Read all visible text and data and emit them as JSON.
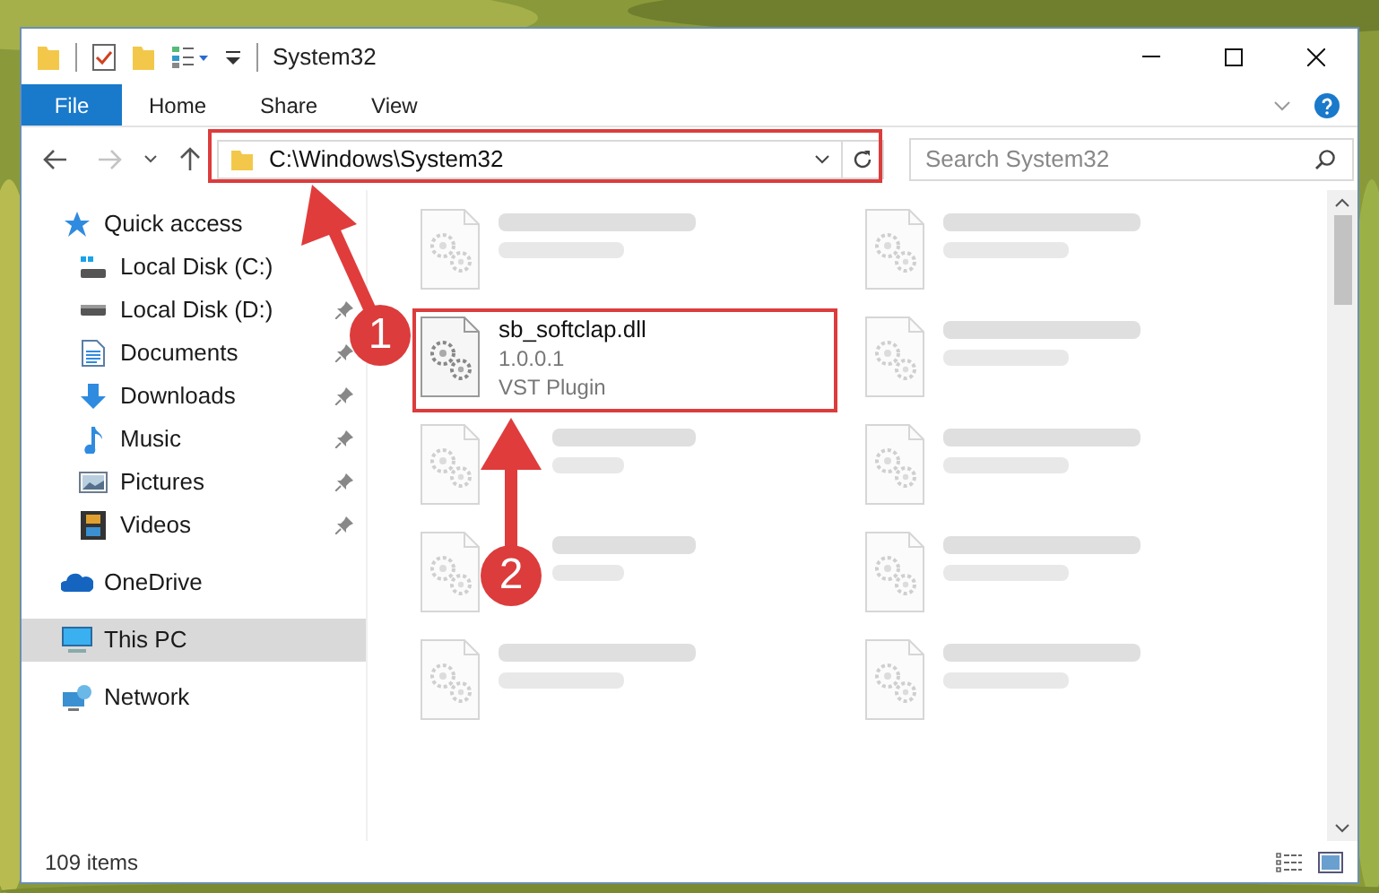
{
  "window": {
    "title": "System32"
  },
  "ribbon": {
    "tabs": [
      {
        "label": "File",
        "kind": "file"
      },
      {
        "label": "Home",
        "kind": "tab"
      },
      {
        "label": "Share",
        "kind": "tab"
      },
      {
        "label": "View",
        "kind": "tab"
      }
    ]
  },
  "address_bar": {
    "path": "C:\\Windows\\System32"
  },
  "search": {
    "placeholder": "Search System32"
  },
  "nav": {
    "items": [
      {
        "label": "Quick access",
        "kind": "star",
        "selected": false,
        "children": [
          {
            "label": "Local Disk (C:)",
            "kind": "diskc",
            "pinned": false,
            "selected": false
          },
          {
            "label": "Local Disk (D:)",
            "kind": "disk",
            "pinned": true,
            "selected": false
          },
          {
            "label": "Documents",
            "kind": "documents",
            "pinned": true,
            "selected": false
          },
          {
            "label": "Downloads",
            "kind": "downloads",
            "pinned": true,
            "selected": false
          },
          {
            "label": "Music",
            "kind": "music",
            "pinned": true,
            "selected": false
          },
          {
            "label": "Pictures",
            "kind": "pictures",
            "pinned": true,
            "selected": false
          },
          {
            "label": "Videos",
            "kind": "videos",
            "pinned": true,
            "selected": false
          }
        ]
      },
      {
        "label": "OneDrive",
        "kind": "cloud",
        "selected": false
      },
      {
        "label": "This PC",
        "kind": "pc",
        "selected": true
      },
      {
        "label": "Network",
        "kind": "network",
        "selected": false
      }
    ]
  },
  "files": [
    {
      "kind": "blurred"
    },
    {
      "kind": "blurred"
    },
    {
      "kind": "file",
      "name": "sb_softclap.dll",
      "version": "1.0.0.1",
      "type": "VST Plugin"
    },
    {
      "kind": "blurred"
    },
    {
      "kind": "covered"
    },
    {
      "kind": "blurred"
    },
    {
      "kind": "covered"
    },
    {
      "kind": "blurred"
    },
    {
      "kind": "blurred"
    },
    {
      "kind": "blurred"
    }
  ],
  "status_bar": {
    "count": "109 items"
  },
  "annotations": [
    {
      "label": "1"
    },
    {
      "label": "2"
    }
  ]
}
